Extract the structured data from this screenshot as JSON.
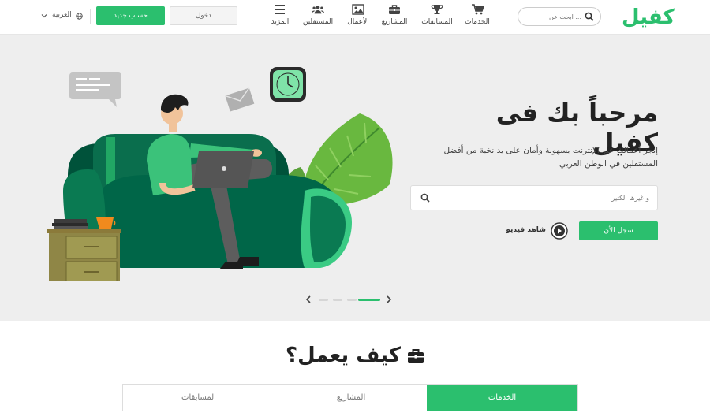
{
  "header": {
    "logo_text": "كفيل",
    "search_placeholder": "ابحث عن ...",
    "nav": [
      {
        "label": "الخدمات",
        "icon": "cart-icon"
      },
      {
        "label": "المسابقات",
        "icon": "trophy-icon"
      },
      {
        "label": "المشاريع",
        "icon": "briefcase-icon"
      },
      {
        "label": "الأعمال",
        "icon": "image-icon"
      },
      {
        "label": "المستقلين",
        "icon": "users-icon"
      },
      {
        "label": "المزيد",
        "icon": "menu-icon"
      }
    ],
    "new_account": "حساب جديد",
    "login": "دخول",
    "language": "العربية"
  },
  "hero": {
    "title": "مرحباً بك فى كفيل",
    "subtitle": "إنجز أعمالك عبر الإنترنت بسهولة وأمان على يد نخبة من أفضل المستقلين في الوطن العربي",
    "search_placeholder": "و غيرها الكثير",
    "register": "سجل الأن",
    "watch_video": "شاهد فيديو"
  },
  "how": {
    "title": "كيف يعمل؟",
    "tabs": [
      "الخدمات",
      "المشاريع",
      "المسابقات"
    ]
  },
  "colors": {
    "accent": "#2bbf6e",
    "hero_bg": "#eeeeee"
  }
}
